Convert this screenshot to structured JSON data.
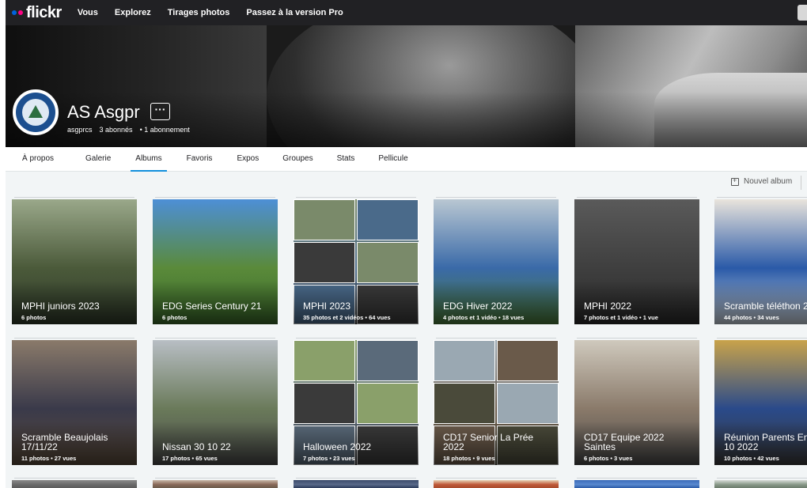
{
  "brand": {
    "name": "flickr",
    "dot1": "#0063dc",
    "dot2": "#ff0084"
  },
  "nav": {
    "items": [
      "Vous",
      "Explorez",
      "Tirages photos",
      "Passez à la version Pro"
    ]
  },
  "profile": {
    "name": "AS Asgpr",
    "more_label": "···",
    "handle": "asgprcs",
    "followers": "3 abonnés",
    "following": "• 1 abonnement"
  },
  "tabs": [
    "À propos",
    "Galerie",
    "Albums",
    "Favoris",
    "Expos",
    "Groupes",
    "Stats",
    "Pellicule"
  ],
  "active_tab": "Albums",
  "accent": "#128fdc",
  "new_album_label": "Nouvel album",
  "albums": [
    {
      "title": "MPHI juniors 2023",
      "info": "6 photos",
      "colors": [
        "#9aa88a",
        "#4b5a3a",
        "#2f3a2a"
      ]
    },
    {
      "title": "EDG Series Century 21",
      "info": "6 photos",
      "colors": [
        "#4d8fd6",
        "#5a8a3a",
        "#3a6a2a"
      ]
    },
    {
      "title": "MPHI 2023",
      "info": "35 photos et 2 vidéos  •  64 vues",
      "colors": [
        "#7a8a6a",
        "#4a6a8a",
        "#3a3a3a"
      ]
    },
    {
      "title": "EDG Hiver 2022",
      "info": "4 photos et 1 vidéo  •  18 vues",
      "colors": [
        "#b9c7d2",
        "#3a6aa8",
        "#4a7a3a"
      ]
    },
    {
      "title": "MPHI 2022",
      "info": "7 photos et 1 vidéo  •  1 vue",
      "colors": [
        "#5a5a5a",
        "#3f3f3f",
        "#2a2a2a"
      ]
    },
    {
      "title": "Scramble téléthon 2",
      "info": "44 photos  •  34 vues",
      "colors": [
        "#e9e4dc",
        "#2a5aa8",
        "#c9d3dc"
      ]
    },
    {
      "title": "Scramble Beaujolais\n17/11/22",
      "info": "11 photos  •  27 vues",
      "colors": [
        "#8a7a6a",
        "#3a3a4a",
        "#5a4a3a"
      ]
    },
    {
      "title": "Nissan 30 10 22",
      "info": "17 photos  •  65 vues",
      "colors": [
        "#b8bec4",
        "#6a7a5a",
        "#4a4a4a"
      ]
    },
    {
      "title": "Halloween 2022",
      "info": "7 photos  •  23 vues",
      "colors": [
        "#8aa06a",
        "#5a6a7a",
        "#3a3a3a"
      ]
    },
    {
      "title": "CD17 Senior La Prée\n2022",
      "info": "18 photos  •  9 vues",
      "colors": [
        "#9aa8b2",
        "#6a5a4a",
        "#4a4a3a"
      ]
    },
    {
      "title": "CD17 Equipe 2022\nSaintes",
      "info": "6 photos  •  3 vues",
      "colors": [
        "#cfc9bd",
        "#8a7a6a",
        "#4a4a4a"
      ]
    },
    {
      "title": "Réunion Parents En\n10 2022",
      "info": "10 photos  •  42 vues",
      "colors": [
        "#c9a34a",
        "#2a4a8a",
        "#3a3a3a"
      ]
    },
    {
      "title": "",
      "info": "",
      "colors": [
        "#8a8a8a",
        "#6a6a6a",
        "#5a5a5a"
      ]
    },
    {
      "title": "",
      "info": "",
      "colors": [
        "#c9b8a8",
        "#8a6a5a",
        "#6a5a4a"
      ]
    },
    {
      "title": "",
      "info": "",
      "colors": [
        "#3a4a6a",
        "#5a6a8a",
        "#2a3a5a"
      ]
    },
    {
      "title": "",
      "info": "",
      "colors": [
        "#e8d6b8",
        "#c05a3a",
        "#a84a2a"
      ]
    },
    {
      "title": "",
      "info": "",
      "colors": [
        "#3a6ab8",
        "#5a8ad0",
        "#2a5aa8"
      ]
    },
    {
      "title": "",
      "info": "",
      "colors": [
        "#d8dcd8",
        "#8a9a8a",
        "#6a7a6a"
      ]
    }
  ]
}
